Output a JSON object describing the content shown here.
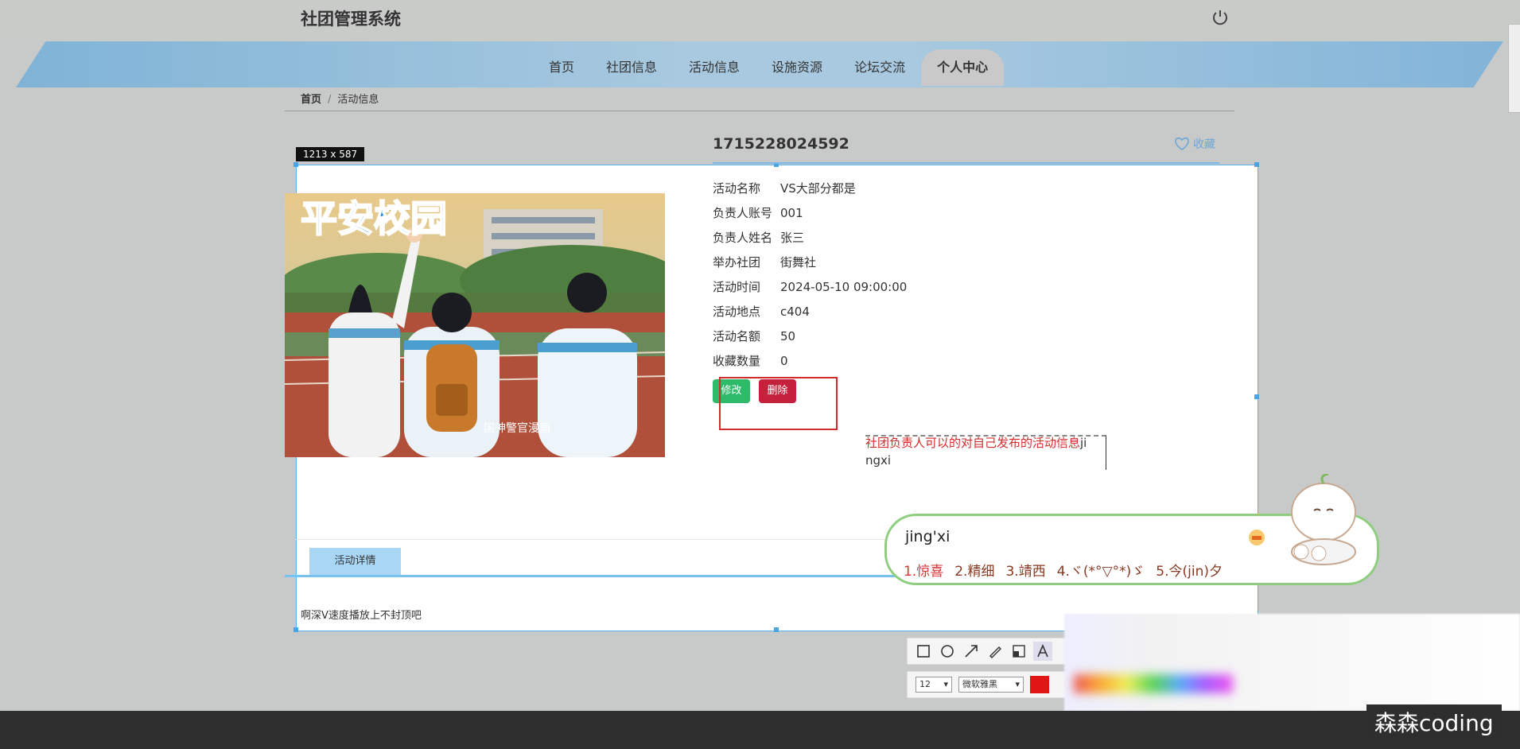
{
  "header": {
    "title": "社团管理系统"
  },
  "nav": {
    "items": [
      {
        "label": "首页"
      },
      {
        "label": "社团信息"
      },
      {
        "label": "活动信息"
      },
      {
        "label": "设施资源"
      },
      {
        "label": "论坛交流"
      },
      {
        "label": "个人中心"
      }
    ]
  },
  "breadcrumb": {
    "home": "首页",
    "sep": "/",
    "current": "活动信息"
  },
  "capture": {
    "dimensions": "1213 x 587"
  },
  "activity": {
    "id_title": "1715228024592",
    "favorite_label": "收藏",
    "poster_text": "平安校园",
    "poster_watermark": "国神警官漫画",
    "fields": [
      {
        "label": "活动名称",
        "value": "VS大部分都是"
      },
      {
        "label": "负责人账号",
        "value": "001"
      },
      {
        "label": "负责人姓名",
        "value": "张三"
      },
      {
        "label": "举办社团",
        "value": "街舞社"
      },
      {
        "label": "活动时间",
        "value": "2024-05-10 09:00:00"
      },
      {
        "label": "活动地点",
        "value": "c404"
      },
      {
        "label": "活动名额",
        "value": "50"
      },
      {
        "label": "收藏数量",
        "value": "0"
      }
    ],
    "edit_label": "修改",
    "delete_label": "删除"
  },
  "annotation": {
    "text_red": "社团负责人可以的对自己发布的活动信息",
    "text_tail": "ji",
    "text_line2": "ngxi"
  },
  "tabs": {
    "detail_label": "活动详情"
  },
  "detail_text": "啊深V速度播放上不封顶吧",
  "ime": {
    "input": "jing'xi",
    "candidates": [
      "1.惊喜",
      "2.精细",
      "3.靖西",
      "4.ヾ(*°▽°*)ゞ",
      "5.今(jin)夕"
    ]
  },
  "toolbar": {
    "font_size": "12",
    "font_family": "微软雅黑",
    "color": "#e21515"
  },
  "watermark": "森森coding"
}
